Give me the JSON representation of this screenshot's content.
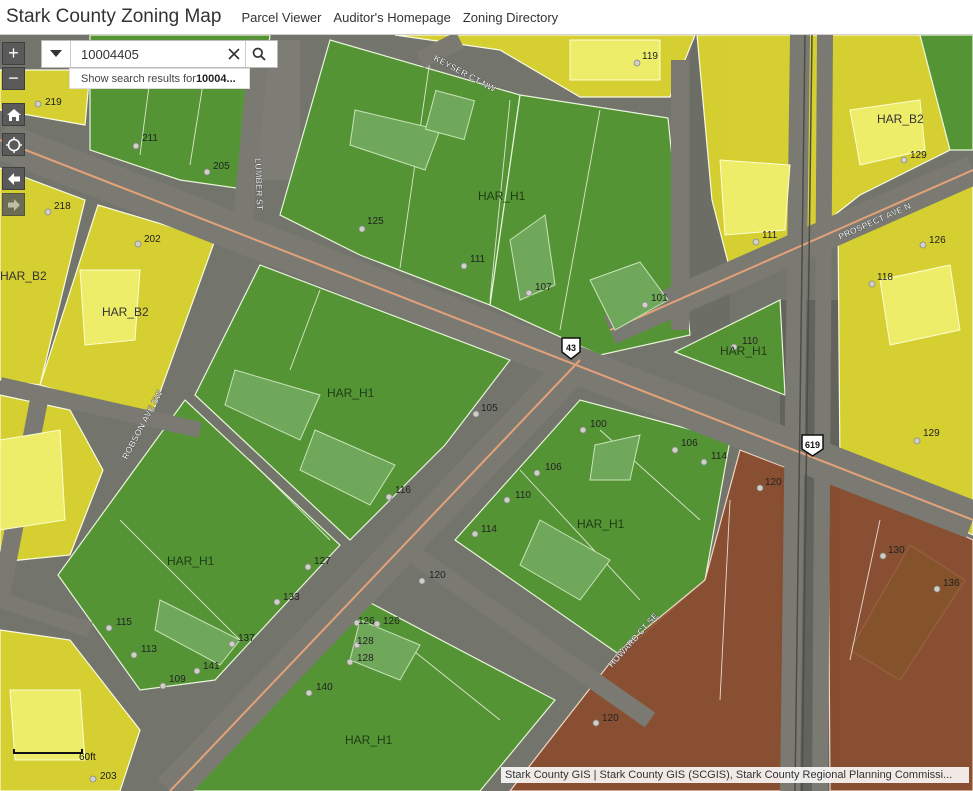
{
  "header": {
    "title": "Stark County Zoning Map",
    "nav": [
      "Parcel Viewer",
      "Auditor's Homepage",
      "Zoning Directory"
    ]
  },
  "search": {
    "value": "10004405",
    "suggestion_prefix": "Show search results for ",
    "suggestion_term": "10004..."
  },
  "controls": {
    "zoom_in": "+",
    "zoom_out": "−",
    "home_icon": "home-icon",
    "locate_icon": "locate-icon",
    "back_icon": "arrow-left-icon",
    "forward_icon": "arrow-right-icon"
  },
  "colors": {
    "zone_b2": "#e2dc2a",
    "zone_h1": "#4f9a2c",
    "zone_industrial": "#8c4a2a",
    "road": "#77776f",
    "road_centerline": "#f0a67a"
  },
  "zone_labels": {
    "b2_left": "HAR_B2",
    "b2_mid": "HAR_B2",
    "b2_right": "HAR_B2",
    "h1_a": "HAR_H1",
    "h1_b": "HAR_H1",
    "h1_c": "HAR_H1",
    "h1_d": "HAR_H1",
    "h1_e": "HAR_H1",
    "h1_f": "HAR_H1"
  },
  "streets": {
    "keyser": "KEYSER CT NW",
    "prospect": "PROSPECT AVE N",
    "robson": "ROBSON AVE SW",
    "howard": "HOWARD CT SE",
    "lumber": "LUMBER ST"
  },
  "route_shields": {
    "r43": "43",
    "r619": "619"
  },
  "parcels": {
    "p219": "219",
    "p211": "211",
    "p205": "205",
    "p218": "218",
    "p202": "202",
    "p125": "125",
    "p111a": "111",
    "p107": "107",
    "p101": "101",
    "p119": "119",
    "p129a": "129",
    "p111b": "111",
    "p126a": "126",
    "p118": "118",
    "p110a": "110",
    "p129b": "129",
    "p105": "105",
    "p100": "100",
    "p106a": "106",
    "p114a": "114",
    "p106b": "106",
    "p110b": "110",
    "p114b": "114",
    "p116": "116",
    "p127": "127",
    "p133": "133",
    "p137": "137",
    "p141": "141",
    "p109": "109",
    "p113": "113",
    "p115": "115",
    "p120a": "120",
    "p126b": "126",
    "p126c": "126",
    "p128a": "128",
    "p128b": "128",
    "p140": "140",
    "p120b": "120",
    "p130": "130",
    "p136": "136",
    "p120c": "120",
    "p203": "203"
  },
  "scalebar": {
    "label": "60ft"
  },
  "attribution": "Stark County GIS | Stark County GIS (SCGIS), Stark County Regional Planning Commissi..."
}
